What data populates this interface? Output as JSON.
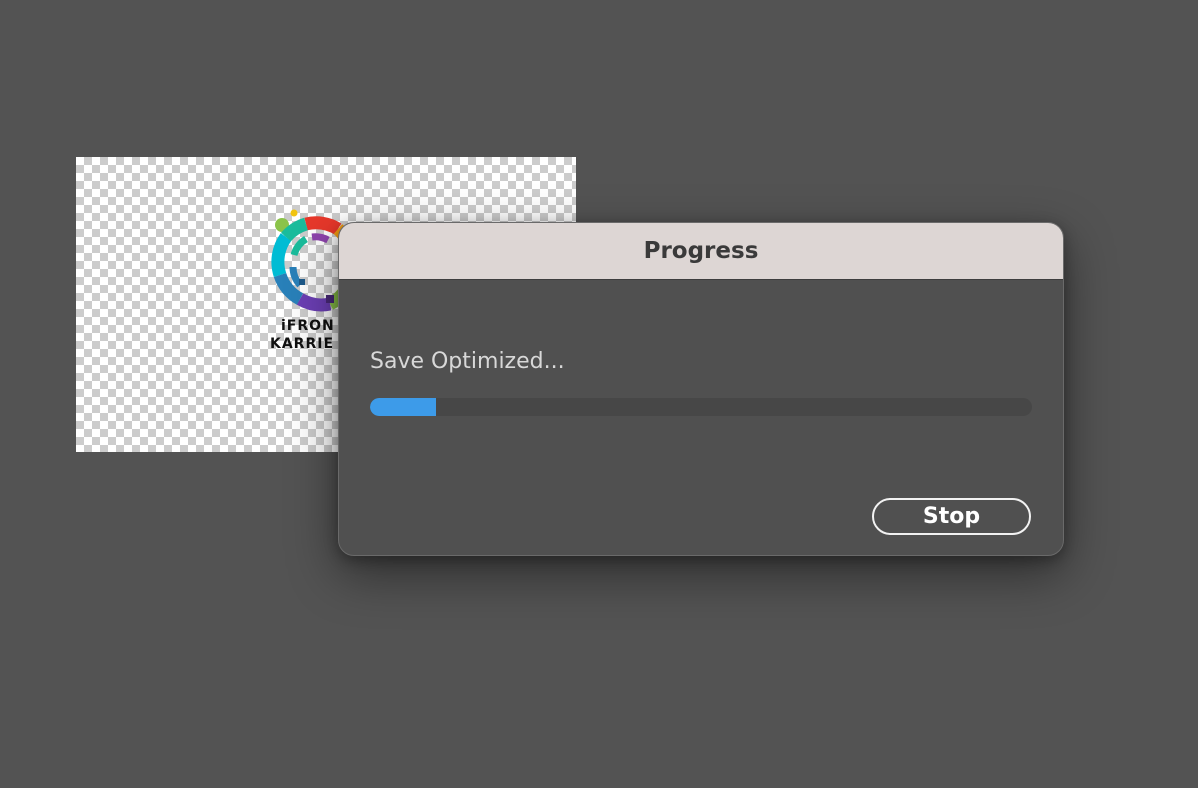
{
  "document": {
    "logo_line1": "iFRON",
    "logo_line2": "KARRIE",
    "logo_colors": [
      "#e8382b",
      "#f39c12",
      "#f1c40f",
      "#8bc34a",
      "#4caf50",
      "#1abc9c",
      "#00bcd4",
      "#2980b9",
      "#6c3fb5",
      "#8e44ad"
    ]
  },
  "dialog": {
    "title": "Progress",
    "status_text": "Save Optimized...",
    "progress_fraction": 0.1,
    "progress_color": "#3d9be9",
    "stop_label": "Stop"
  }
}
